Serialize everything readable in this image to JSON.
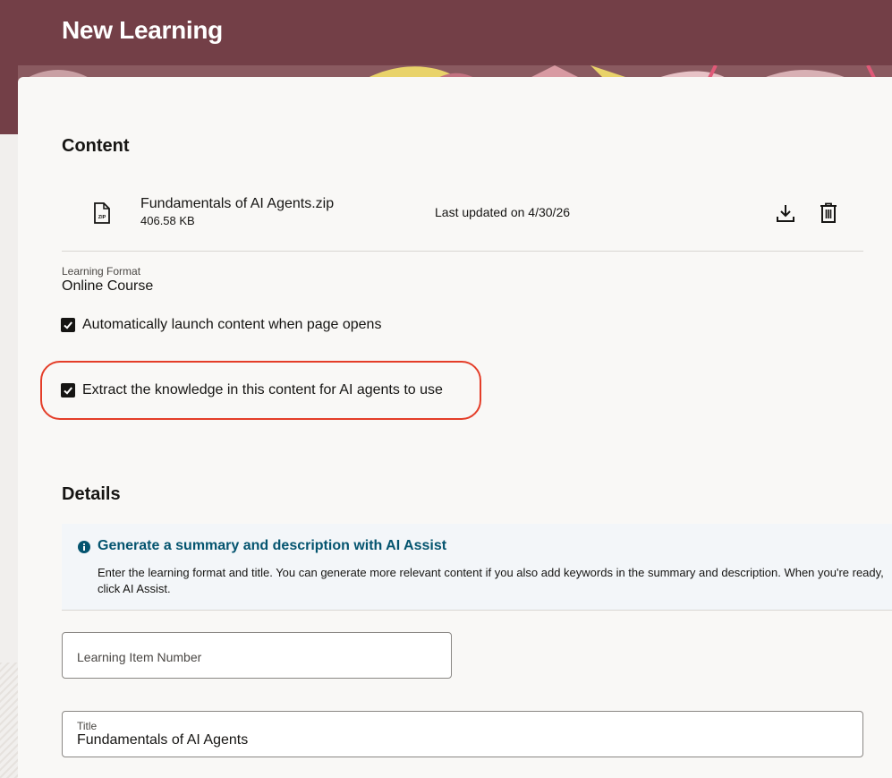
{
  "header": {
    "title": "New Learning"
  },
  "content_section": {
    "title": "Content",
    "file": {
      "name": "Fundamentals of AI Agents.zip",
      "size": "406.58 KB",
      "updated": "Last updated on 4/30/26",
      "icon": "zip-file-icon"
    },
    "learning_format": {
      "label": "Learning Format",
      "value": "Online Course"
    },
    "auto_launch": {
      "label": "Automatically launch content when page opens",
      "checked": true
    },
    "extract_knowledge": {
      "label": "Extract the knowledge in this content for AI agents to use",
      "checked": true
    }
  },
  "details_section": {
    "title": "Details",
    "ai_banner": {
      "title": "Generate a summary and description with AI Assist",
      "text": "Enter the learning format and title. You can generate more relevant content if you also add keywords in the summary and description. When you're ready, click AI Assist."
    },
    "learning_item_number": {
      "placeholder": "Learning Item Number",
      "value": ""
    },
    "title_field": {
      "label": "Title",
      "value": "Fundamentals of AI Agents"
    }
  },
  "colors": {
    "header": "#733f47",
    "accent_blue": "#04546f",
    "highlight": "#e43d28"
  }
}
